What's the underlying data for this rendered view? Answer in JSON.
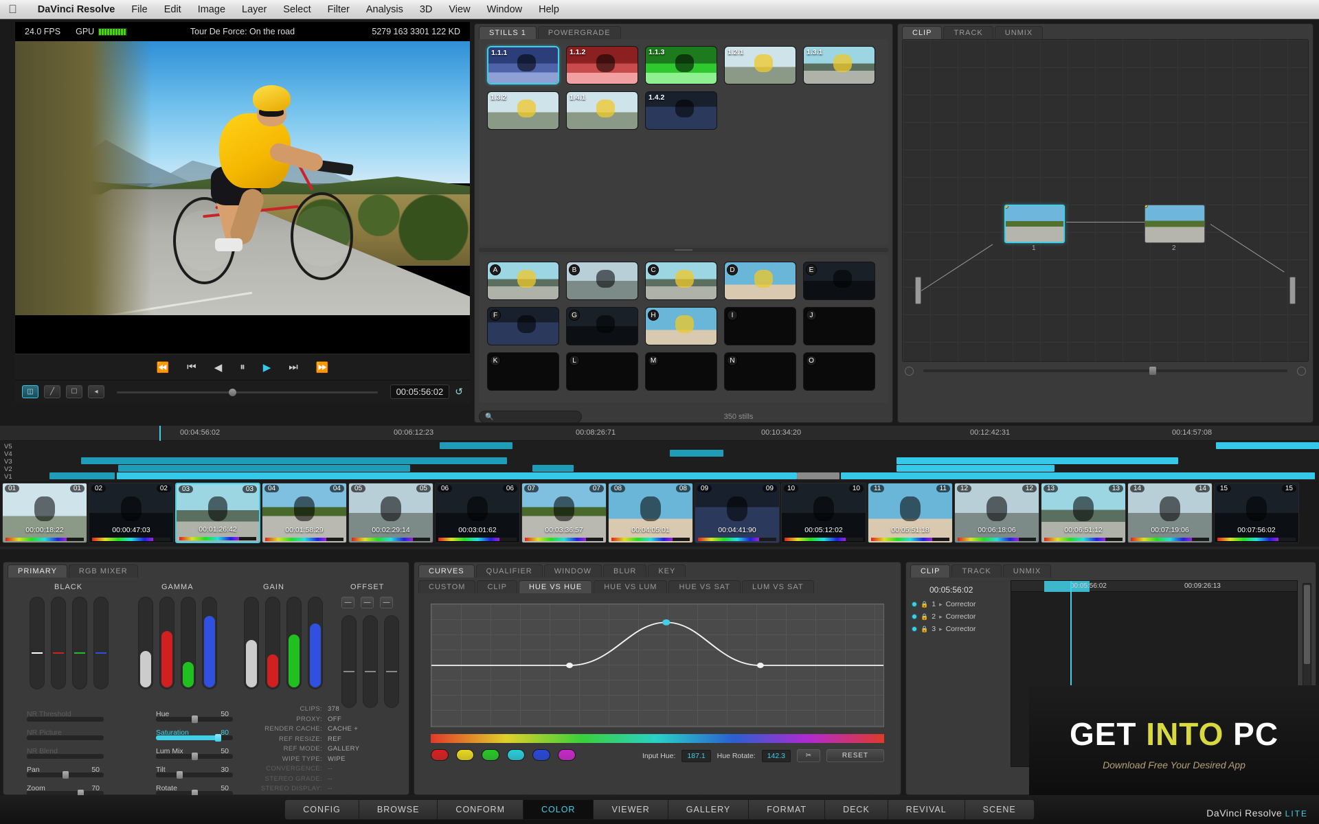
{
  "menubar": {
    "apple": "apple-icon",
    "items": [
      "DaVinci Resolve",
      "File",
      "Edit",
      "Image",
      "Layer",
      "Select",
      "Filter",
      "Analysis",
      "3D",
      "View",
      "Window",
      "Help"
    ]
  },
  "viewer": {
    "fps": "24.0 FPS",
    "gpu_label": "GPU",
    "title": "Tour De Force: On the road",
    "numbers": "5279 163 3301 122 KD",
    "transport": [
      "rewind-icon",
      "first-frame-icon",
      "step-back-icon",
      "pause-icon",
      "play-icon",
      "step-forward-icon",
      "fast-forward-icon"
    ],
    "timecode": "00:05:56:02",
    "mode_buttons": [
      "wipe-icon",
      "cursor-icon",
      "screen-icon",
      "speaker-icon"
    ],
    "loop_icon": "loop-icon"
  },
  "gallery": {
    "tabs": [
      {
        "label": "STILLS 1",
        "active": true
      },
      {
        "label": "POWERGRADE",
        "active": false
      }
    ],
    "stills": [
      {
        "label": "1.1.1",
        "theme": "th-blue",
        "selected": true
      },
      {
        "label": "1.1.2",
        "theme": "th-red",
        "selected": false
      },
      {
        "label": "1.1.3",
        "theme": "th-green",
        "selected": false
      },
      {
        "label": "1.2.1",
        "theme": "th-pale",
        "selected": false
      },
      {
        "label": "1.3.1",
        "theme": "th-cyan",
        "selected": false
      },
      {
        "label": "1.3.2",
        "theme": "th-pale",
        "selected": false
      },
      {
        "label": "1.4.1",
        "theme": "th-pale",
        "selected": false
      },
      {
        "label": "1.4.2",
        "theme": "th-navy",
        "selected": false
      }
    ],
    "clip_stills": [
      {
        "label": "A",
        "theme": "th-cyan",
        "empty": false
      },
      {
        "label": "B",
        "theme": "th-sil",
        "empty": false
      },
      {
        "label": "C",
        "theme": "th-cyan",
        "empty": false
      },
      {
        "label": "D",
        "theme": "th-sky",
        "empty": false
      },
      {
        "label": "E",
        "theme": "th-dark",
        "empty": false
      },
      {
        "label": "F",
        "theme": "th-navy",
        "empty": false
      },
      {
        "label": "G",
        "theme": "th-dark",
        "empty": false
      },
      {
        "label": "H",
        "theme": "th-sky",
        "empty": false
      },
      {
        "label": "I",
        "theme": "th-black",
        "empty": true
      },
      {
        "label": "J",
        "theme": "th-black",
        "empty": true
      },
      {
        "label": "K",
        "theme": "th-black",
        "empty": true
      },
      {
        "label": "L",
        "theme": "th-black",
        "empty": true
      },
      {
        "label": "M",
        "theme": "th-black",
        "empty": true
      },
      {
        "label": "N",
        "theme": "th-black",
        "empty": true
      },
      {
        "label": "O",
        "theme": "th-black",
        "empty": true
      }
    ],
    "search_placeholder": "",
    "stills_count": "350 stills"
  },
  "nodes": {
    "tabs": [
      {
        "label": "CLIP",
        "active": true
      },
      {
        "label": "TRACK",
        "active": false
      },
      {
        "label": "UNMIX",
        "active": false
      }
    ],
    "items": [
      {
        "number": "1",
        "selected": true
      },
      {
        "number": "2",
        "selected": false
      }
    ]
  },
  "timeline": {
    "ticks": [
      "00:04:56:02",
      "00:06:12:23",
      "00:08:26:71",
      "00:10:34:20",
      "00:12:42:31",
      "00:14:57:08"
    ],
    "track_labels": [
      "V5",
      "V4",
      "V3",
      "V2",
      "V1"
    ],
    "clips": [
      {
        "n": "01",
        "tc": "00:00:18:22",
        "theme": "th-pale",
        "selected": false
      },
      {
        "n": "02",
        "tc": "00:00:47:03",
        "theme": "th-dark",
        "selected": false
      },
      {
        "n": "03",
        "tc": "00:01:26:42",
        "theme": "th-cyan",
        "selected": true
      },
      {
        "n": "04",
        "tc": "00:01:58:29",
        "theme": "th-road",
        "selected": false
      },
      {
        "n": "05",
        "tc": "00:02:29:14",
        "theme": "th-sil",
        "selected": false
      },
      {
        "n": "06",
        "tc": "00:03:01:62",
        "theme": "th-dark",
        "selected": false
      },
      {
        "n": "07",
        "tc": "00:03:36:57",
        "theme": "th-road",
        "selected": false
      },
      {
        "n": "08",
        "tc": "00:04:05:01",
        "theme": "th-sky",
        "selected": false
      },
      {
        "n": "09",
        "tc": "00:04:41:90",
        "theme": "th-navy",
        "selected": false
      },
      {
        "n": "10",
        "tc": "00:05:12:02",
        "theme": "th-dark",
        "selected": false
      },
      {
        "n": "11",
        "tc": "00:05:51:18",
        "theme": "th-sky",
        "selected": false
      },
      {
        "n": "12",
        "tc": "00:06:18:06",
        "theme": "th-sil",
        "selected": false
      },
      {
        "n": "13",
        "tc": "00:06:51:12",
        "theme": "th-cyan",
        "selected": false
      },
      {
        "n": "14",
        "tc": "00:07:19:06",
        "theme": "th-sil",
        "selected": false
      },
      {
        "n": "15",
        "tc": "00:07:56:02",
        "theme": "th-dark",
        "selected": false
      }
    ]
  },
  "primary": {
    "tabs": [
      {
        "label": "PRIMARY",
        "active": true
      },
      {
        "label": "RGB MIXER",
        "active": false
      }
    ],
    "groups": [
      {
        "name": "BLACK",
        "sliders": [
          {
            "value": "0.00",
            "color": "#ffffff",
            "fill": 0,
            "channel": "master"
          },
          {
            "value": "0.00",
            "color": "#d02020",
            "fill": 0,
            "channel": "red"
          },
          {
            "value": "0.00",
            "color": "#20c020",
            "fill": 0,
            "channel": "green"
          },
          {
            "value": "0.00",
            "color": "#3050e0",
            "fill": 0,
            "channel": "blue"
          }
        ]
      },
      {
        "name": "GAMMA",
        "sliders": [
          {
            "value": "0.50",
            "color": "#cccccc",
            "fill": 40,
            "channel": "master"
          },
          {
            "value": "-1.00",
            "color": "#d02020",
            "fill": 62,
            "channel": "red"
          },
          {
            "value": "-0.50",
            "color": "#20c020",
            "fill": 28,
            "channel": "green"
          },
          {
            "value": "1.00",
            "color": "#3050e0",
            "fill": 78,
            "channel": "blue"
          }
        ]
      },
      {
        "name": "GAIN",
        "sliders": [
          {
            "value": "1.00",
            "color": "#cccccc",
            "fill": 52,
            "channel": "master",
            "hl": true
          },
          {
            "value": "0.20",
            "color": "#d02020",
            "fill": 36,
            "channel": "red",
            "hl": true
          },
          {
            "value": "0.75",
            "color": "#20c020",
            "fill": 58,
            "channel": "green",
            "hl": true
          },
          {
            "value": "0.50",
            "color": "#3050e0",
            "fill": 70,
            "channel": "blue",
            "hl": true
          }
        ]
      },
      {
        "name": "OFFSET",
        "sliders": [
          {
            "value": "25.00",
            "color": "#888888",
            "fill": 0,
            "channel": "red"
          },
          {
            "value": "25.00",
            "color": "#888888",
            "fill": 0,
            "channel": "green"
          },
          {
            "value": "25.00",
            "color": "#888888",
            "fill": 0,
            "channel": "blue"
          }
        ]
      }
    ],
    "left_controls": [
      {
        "label": "NR Threshold",
        "value": "",
        "disabled": true,
        "pos": 0
      },
      {
        "label": "NR Picture",
        "value": "",
        "disabled": true,
        "pos": 0
      },
      {
        "label": "NR Blend",
        "value": "",
        "disabled": true,
        "pos": 0
      },
      {
        "label": "Pan",
        "value": "50",
        "disabled": false,
        "pos": 50
      },
      {
        "label": "Zoom",
        "value": "70",
        "disabled": false,
        "pos": 70
      }
    ],
    "mid_controls": [
      {
        "label": "Hue",
        "value": "50",
        "disabled": false,
        "pos": 50,
        "highlight": false
      },
      {
        "label": "Saturation",
        "value": "80",
        "disabled": false,
        "pos": 80,
        "highlight": true
      },
      {
        "label": "Lum Mix",
        "value": "50",
        "disabled": false,
        "pos": 50,
        "highlight": false
      },
      {
        "label": "Tilt",
        "value": "30",
        "disabled": false,
        "pos": 30,
        "highlight": false
      },
      {
        "label": "Rotate",
        "value": "50",
        "disabled": false,
        "pos": 50,
        "highlight": false
      }
    ],
    "info": [
      {
        "key": "CLIPS:",
        "val": "378"
      },
      {
        "key": "PROXY:",
        "val": "OFF"
      },
      {
        "key": "RENDER CACHE:",
        "val": "CACHE +"
      },
      {
        "key": "REF RESIZE:",
        "val": "REF"
      },
      {
        "key": "REF MODE:",
        "val": "GALLERY"
      },
      {
        "key": "WIPE TYPE:",
        "val": "WIPE"
      },
      {
        "key": "CONVERGENCE:",
        "val": "--"
      },
      {
        "key": "STEREO GRADE:",
        "val": "--"
      },
      {
        "key": "STEREO DISPLAY:",
        "val": "--"
      }
    ]
  },
  "curves": {
    "tabs_top": [
      {
        "label": "CURVES",
        "active": true
      },
      {
        "label": "QUALIFIER",
        "active": false
      },
      {
        "label": "WINDOW",
        "active": false
      },
      {
        "label": "BLUR",
        "active": false
      },
      {
        "label": "KEY",
        "active": false
      }
    ],
    "tabs_sub": [
      {
        "label": "CUSTOM",
        "active": false
      },
      {
        "label": "CLIP",
        "active": false
      },
      {
        "label": "HUE VS HUE",
        "active": true
      },
      {
        "label": "HUE VS LUM",
        "active": false
      },
      {
        "label": "HUE VS SAT",
        "active": false
      },
      {
        "label": "LUM VS SAT",
        "active": false
      }
    ],
    "swatches": [
      "#d82020",
      "#e8d820",
      "#28c828",
      "#28ccd8",
      "#2848d8",
      "#c828c8"
    ],
    "input_hue_label": "Input Hue:",
    "input_hue_value": "187.1",
    "hue_rotate_label": "Hue Rotate:",
    "hue_rotate_value": "142.3",
    "picker_icon": "eyedropper-icon",
    "reset_label": "RESET"
  },
  "chart_data": {
    "type": "line",
    "title": "Hue vs Hue curve",
    "xlabel": "Input Hue",
    "ylabel": "Hue Rotate",
    "grid": true,
    "xlim": [
      0,
      360
    ],
    "ylim": [
      -1,
      1
    ],
    "control_points": [
      {
        "x": 110,
        "y": 0.0,
        "handle": true
      },
      {
        "x": 187,
        "y": 0.88,
        "handle": true,
        "selected": true
      },
      {
        "x": 262,
        "y": 0.0,
        "handle": true
      }
    ],
    "curve_shape": "gaussian-bump",
    "annotations": [
      "Input Hue: 187.1",
      "Hue Rotate: 142.3"
    ]
  },
  "clip_panel": {
    "tabs": [
      {
        "label": "CLIP",
        "active": true
      },
      {
        "label": "TRACK",
        "active": false
      },
      {
        "label": "UNMIX",
        "active": false
      }
    ],
    "header_timecode": "00:05:56:02",
    "rows": [
      {
        "index": "1",
        "label": "Corrector"
      },
      {
        "index": "2",
        "label": "Corrector"
      },
      {
        "index": "3",
        "label": "Corrector"
      }
    ],
    "ruler_marks": [
      "00:05:56:02",
      "00:09:26:13"
    ]
  },
  "navbar": {
    "items": [
      {
        "label": "CONFIG",
        "active": false
      },
      {
        "label": "BROWSE",
        "active": false
      },
      {
        "label": "CONFORM",
        "active": false
      },
      {
        "label": "COLOR",
        "active": true
      },
      {
        "label": "VIEWER",
        "active": false
      },
      {
        "label": "GALLERY",
        "active": false
      },
      {
        "label": "FORMAT",
        "active": false
      },
      {
        "label": "DECK",
        "active": false
      },
      {
        "label": "REVIVAL",
        "active": false
      },
      {
        "label": "SCENE",
        "active": false
      }
    ],
    "brand": "DaVinci Resolve",
    "brand_suffix": "LITE"
  },
  "watermark": {
    "get": "GET ",
    "into": "INTO",
    "pc": " PC",
    "subtitle": "Download Free Your Desired App"
  },
  "colors": {
    "accent": "#3fd0e8",
    "panel": "#3a3a3a",
    "dark": "#1a1a1a"
  }
}
